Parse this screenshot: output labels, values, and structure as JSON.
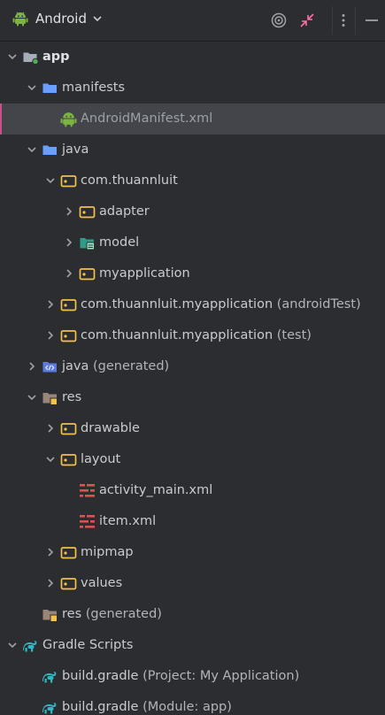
{
  "toolbar": {
    "view_mode": "Android",
    "locate_icon": "target-icon",
    "collapse_icon": "collapse-arrows-icon",
    "options_icon": "vertical-dots-icon",
    "hide_icon": "minus-icon"
  },
  "colors": {
    "background": "#2b2d30",
    "selection": "#43454a",
    "selection_marker": "#c94f8d",
    "folder_blue": "#6b9fff",
    "package_yellow": "#f2c14e",
    "android_green": "#7cb342",
    "layout_red": "#d9534f",
    "gradle_teal": "#2fb9c6"
  },
  "tree": [
    {
      "label": "app",
      "icon": "module-folder-icon"
    },
    {
      "label": "manifests",
      "icon": "folder-icon"
    },
    {
      "label": "AndroidManifest.xml",
      "icon": "android-icon"
    },
    {
      "label": "java",
      "icon": "folder-icon"
    },
    {
      "label": "com.thuannluit",
      "icon": "package-icon"
    },
    {
      "label": "adapter",
      "icon": "package-icon"
    },
    {
      "label": "model",
      "icon": "model-package-icon"
    },
    {
      "label": "myapplication",
      "icon": "package-icon"
    },
    {
      "label": "com.thuannluit.myapplication",
      "hint": " (androidTest)",
      "icon": "package-icon"
    },
    {
      "label": "com.thuannluit.myapplication",
      "hint": " (test)",
      "icon": "package-icon"
    },
    {
      "label": "java",
      "hint": " (generated)",
      "icon": "generated-java-folder-icon"
    },
    {
      "label": "res",
      "icon": "resource-folder-icon"
    },
    {
      "label": "drawable",
      "icon": "package-icon"
    },
    {
      "label": "layout",
      "icon": "package-icon"
    },
    {
      "label": "activity_main.xml",
      "icon": "layout-file-icon"
    },
    {
      "label": "item.xml",
      "icon": "layout-file-icon"
    },
    {
      "label": "mipmap",
      "icon": "package-icon"
    },
    {
      "label": "values",
      "icon": "package-icon"
    },
    {
      "label": "res",
      "hint": " (generated)",
      "icon": "generated-resource-folder-icon"
    },
    {
      "label": "Gradle Scripts",
      "icon": "gradle-icon"
    },
    {
      "label": "build.gradle",
      "hint": " (Project: My Application)",
      "icon": "gradle-icon"
    },
    {
      "label": "build.gradle",
      "hint": " (Module: app)",
      "icon": "gradle-icon"
    }
  ]
}
